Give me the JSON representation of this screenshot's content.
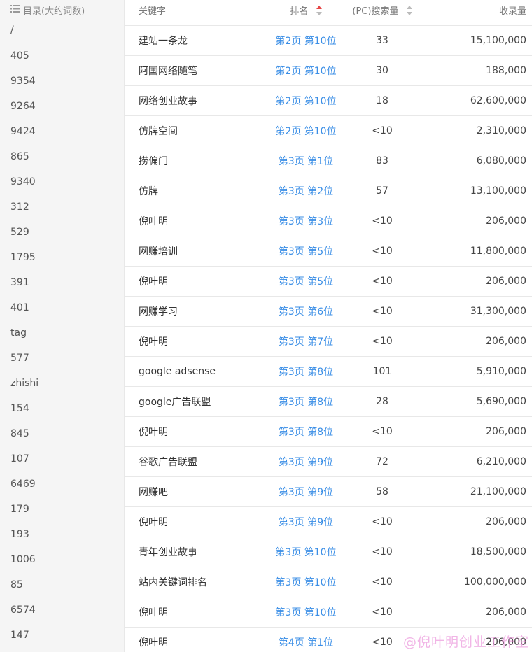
{
  "sidebar": {
    "header": "目录(大约词数)",
    "icon": "list-icon",
    "items": [
      "/",
      "405",
      "9354",
      "9264",
      "9424",
      "865",
      "9340",
      "312",
      "529",
      "1795",
      "391",
      "401",
      "tag",
      "577",
      "zhishi",
      "154",
      "845",
      "107",
      "6469",
      "179",
      "193",
      "1006",
      "85",
      "6574",
      "147"
    ]
  },
  "table": {
    "headers": {
      "keyword": "关键字",
      "rank": "排名",
      "pc": "(PC)搜索量",
      "indexed": "收录量"
    },
    "sort_active_color": "#e64545",
    "rank_link_color": "#3a8ee6",
    "rows": [
      {
        "keyword": "建站一条龙",
        "rank": "第2页 第10位",
        "pc": "33",
        "indexed": "15,100,000"
      },
      {
        "keyword": "阿国网络随笔",
        "rank": "第2页 第10位",
        "pc": "30",
        "indexed": "188,000"
      },
      {
        "keyword": "网络创业故事",
        "rank": "第2页 第10位",
        "pc": "18",
        "indexed": "62,600,000"
      },
      {
        "keyword": "仿牌空间",
        "rank": "第2页 第10位",
        "pc": "<10",
        "indexed": "2,310,000"
      },
      {
        "keyword": "捞偏门",
        "rank": "第3页 第1位",
        "pc": "83",
        "indexed": "6,080,000"
      },
      {
        "keyword": "仿牌",
        "rank": "第3页 第2位",
        "pc": "57",
        "indexed": "13,100,000"
      },
      {
        "keyword": "倪叶明",
        "rank": "第3页 第3位",
        "pc": "<10",
        "indexed": "206,000"
      },
      {
        "keyword": "网赚培训",
        "rank": "第3页 第5位",
        "pc": "<10",
        "indexed": "11,800,000"
      },
      {
        "keyword": "倪叶明",
        "rank": "第3页 第5位",
        "pc": "<10",
        "indexed": "206,000"
      },
      {
        "keyword": "网赚学习",
        "rank": "第3页 第6位",
        "pc": "<10",
        "indexed": "31,300,000"
      },
      {
        "keyword": "倪叶明",
        "rank": "第3页 第7位",
        "pc": "<10",
        "indexed": "206,000"
      },
      {
        "keyword": "google adsense",
        "rank": "第3页 第8位",
        "pc": "101",
        "indexed": "5,910,000"
      },
      {
        "keyword": "google广告联盟",
        "rank": "第3页 第8位",
        "pc": "28",
        "indexed": "5,690,000"
      },
      {
        "keyword": "倪叶明",
        "rank": "第3页 第8位",
        "pc": "<10",
        "indexed": "206,000"
      },
      {
        "keyword": "谷歌广告联盟",
        "rank": "第3页 第9位",
        "pc": "72",
        "indexed": "6,210,000"
      },
      {
        "keyword": "网赚吧",
        "rank": "第3页 第9位",
        "pc": "58",
        "indexed": "21,100,000"
      },
      {
        "keyword": "倪叶明",
        "rank": "第3页 第9位",
        "pc": "<10",
        "indexed": "206,000"
      },
      {
        "keyword": "青年创业故事",
        "rank": "第3页 第10位",
        "pc": "<10",
        "indexed": "18,500,000"
      },
      {
        "keyword": "站内关键词排名",
        "rank": "第3页 第10位",
        "pc": "<10",
        "indexed": "100,000,000"
      },
      {
        "keyword": "倪叶明",
        "rank": "第3页 第10位",
        "pc": "<10",
        "indexed": "206,000"
      },
      {
        "keyword": "倪叶明",
        "rank": "第4页 第1位",
        "pc": "<10",
        "indexed": "206,000"
      }
    ]
  },
  "watermark": "@倪叶明创业工作室"
}
